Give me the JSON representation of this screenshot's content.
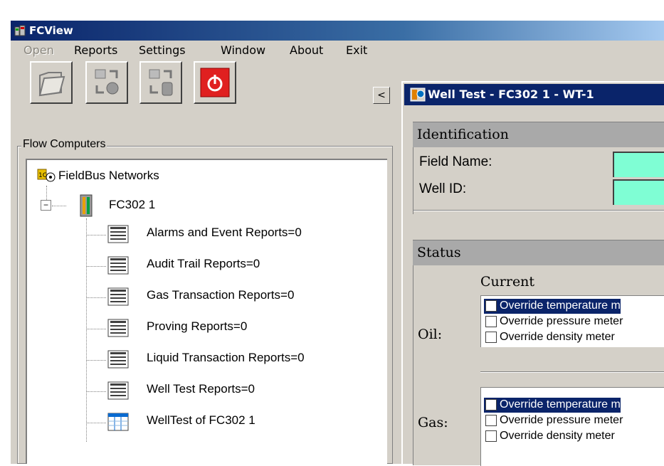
{
  "app": {
    "title": "FCView"
  },
  "menu": [
    {
      "label": "Open",
      "enabled": false
    },
    {
      "label": "Reports",
      "enabled": true
    },
    {
      "label": "Settings",
      "enabled": true
    },
    {
      "label": "Window",
      "enabled": true
    },
    {
      "label": "About",
      "enabled": true
    },
    {
      "label": "Exit",
      "enabled": true
    }
  ],
  "toolbar": {
    "buttons": [
      "open-folder-icon",
      "network-transfer-icon",
      "database-transfer-icon",
      "power-icon"
    ],
    "collapse_label": "<"
  },
  "flow_computers": {
    "group_label": "Flow Computers",
    "root": "FieldBus Networks",
    "device": "FC302 1",
    "expander": "−",
    "items": [
      "Alarms and Event Reports=0",
      "Audit Trail Reports=0",
      "Gas Transaction Reports=0",
      "Proving Reports=0",
      "Liquid Transaction Reports=0",
      "Well Test Reports=0",
      "WellTest of FC302 1"
    ]
  },
  "well_test_window": {
    "title": "Well Test - FC302 1 - WT-1",
    "identification": {
      "header": "Identification",
      "field_name_label": "Field Name:",
      "field_name_value": "",
      "well_id_label": "Well ID:",
      "well_id_value": ""
    },
    "status": {
      "header": "Status",
      "current_label": "Current",
      "oil_label": "Oil:",
      "gas_label": "Gas:",
      "oil_options": [
        {
          "label": "Override temperature m",
          "checked": false,
          "selected": true
        },
        {
          "label": "Override pressure meter",
          "checked": false,
          "selected": false
        },
        {
          "label": "Override density meter",
          "checked": false,
          "selected": false
        }
      ],
      "gas_options": [
        {
          "label": "Override temperature m",
          "checked": false,
          "selected": true
        },
        {
          "label": "Override pressure meter",
          "checked": false,
          "selected": false
        },
        {
          "label": "Override density meter",
          "checked": false,
          "selected": false
        }
      ]
    }
  },
  "colors": {
    "title_active": "#0a246a",
    "field_bg": "#7ffed4",
    "section_header": "#a9a9a9",
    "power_button": "#e02020"
  }
}
